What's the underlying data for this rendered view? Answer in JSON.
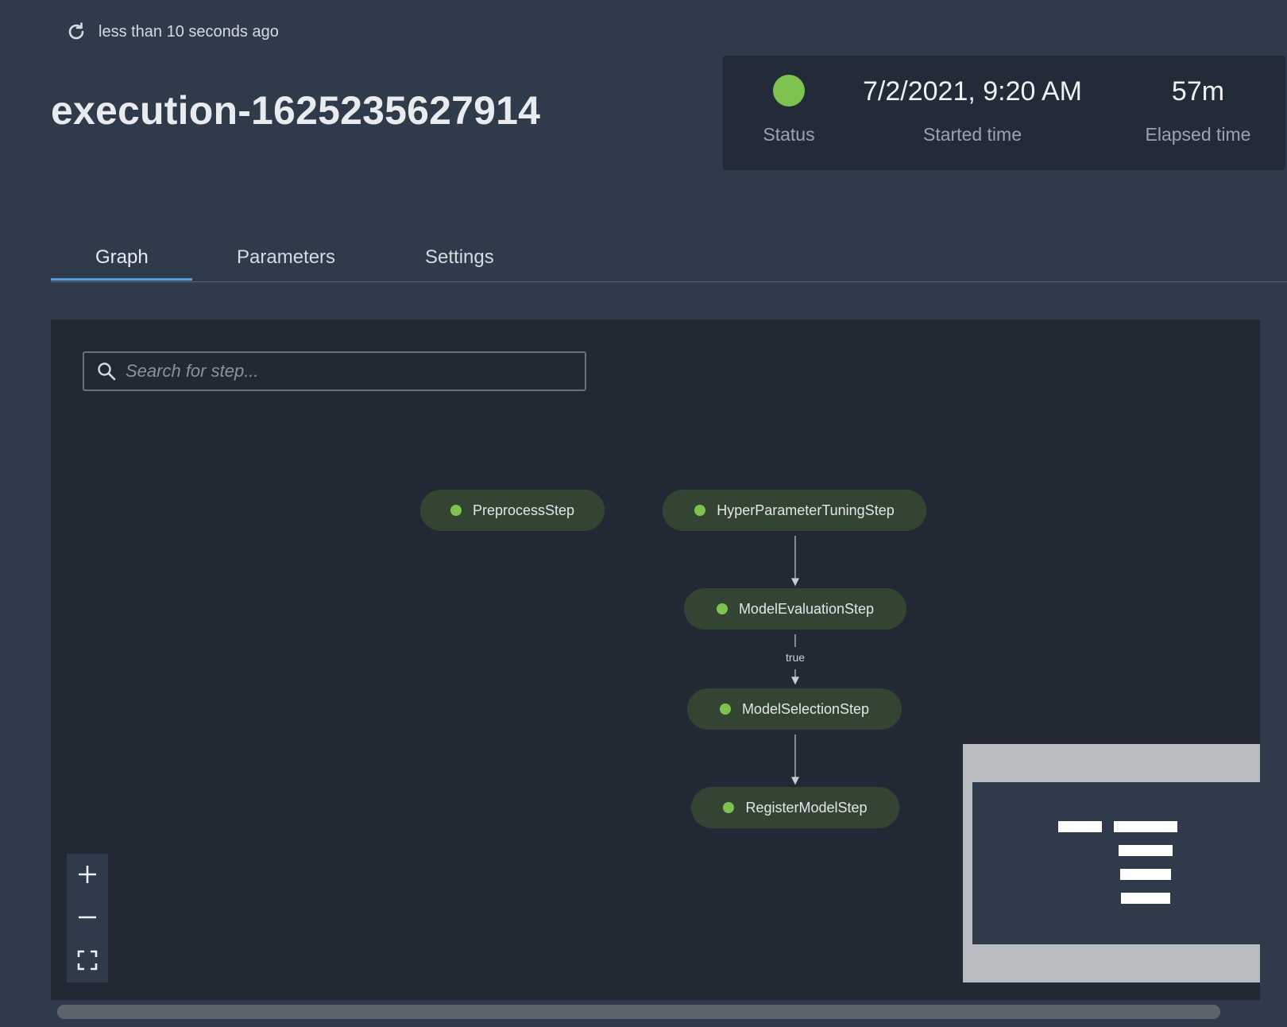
{
  "header": {
    "refresh_text": "less than 10 seconds ago",
    "title": "execution-1625235627914"
  },
  "status_panel": {
    "status_color": "#7ec24f",
    "status_label": "Status",
    "started_value": "7/2/2021, 9:20 AM",
    "started_label": "Started time",
    "elapsed_value": "57m",
    "elapsed_label": "Elapsed time"
  },
  "tabs": [
    {
      "label": "Graph",
      "active": true
    },
    {
      "label": "Parameters",
      "active": false
    },
    {
      "label": "Settings",
      "active": false
    }
  ],
  "graph": {
    "search_placeholder": "Search for step...",
    "nodes": [
      {
        "label": "PreprocessStep",
        "status_color": "#7ec24f"
      },
      {
        "label": "HyperParameterTuningStep",
        "status_color": "#7ec24f"
      },
      {
        "label": "ModelEvaluationStep",
        "status_color": "#7ec24f"
      },
      {
        "label": "ModelSelectionStep",
        "status_color": "#7ec24f"
      },
      {
        "label": "RegisterModelStep",
        "status_color": "#7ec24f"
      }
    ],
    "edges": [
      {
        "from": "HyperParameterTuningStep",
        "to": "ModelEvaluationStep",
        "label": ""
      },
      {
        "from": "ModelEvaluationStep",
        "to": "ModelSelectionStep",
        "label": "true"
      },
      {
        "from": "ModelSelectionStep",
        "to": "RegisterModelStep",
        "label": ""
      }
    ],
    "zoom_controls": [
      "zoom-in-icon",
      "zoom-out-icon",
      "fit-view-icon"
    ]
  }
}
